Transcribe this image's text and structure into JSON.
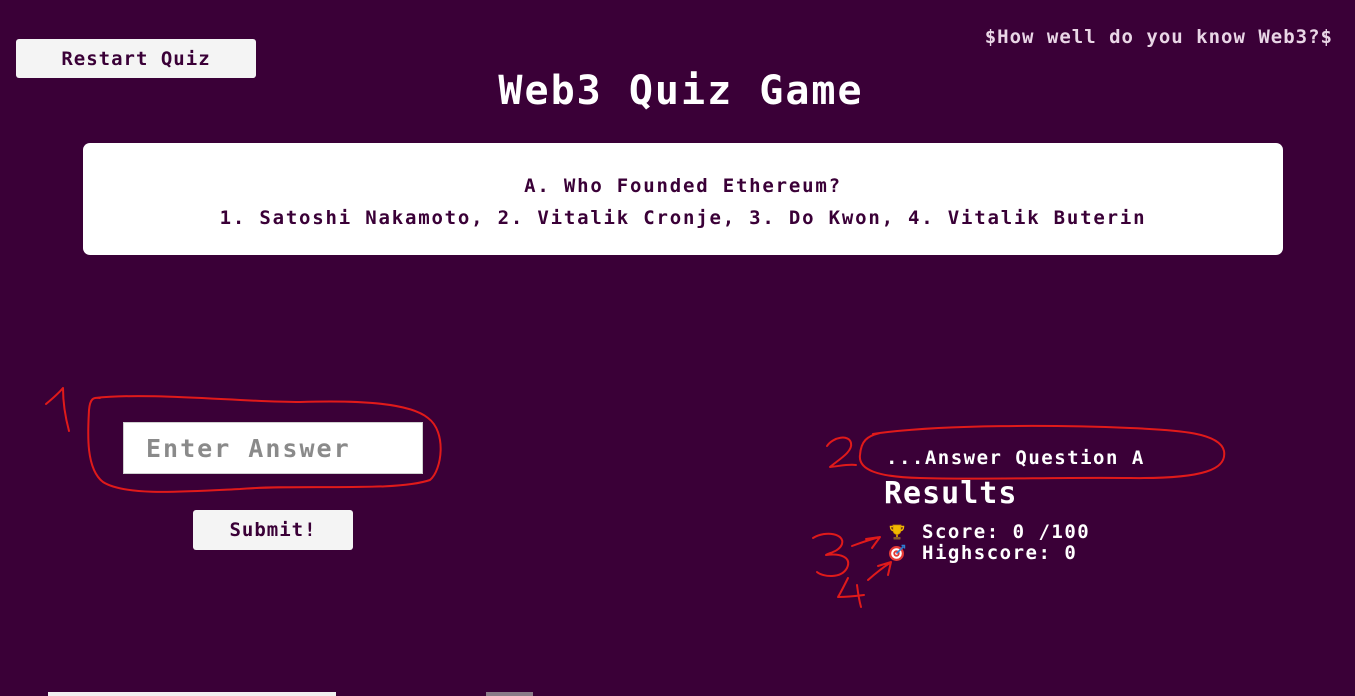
{
  "header": {
    "restart_label": "Restart Quiz",
    "tagline": "$How well do you know Web3?$",
    "title": "Web3 Quiz Game"
  },
  "question": {
    "prompt": "A. Who Founded Ethereum?",
    "options": "1. Satoshi Nakamoto, 2. Vitalik Cronje, 3. Do Kwon, 4. Vitalik Buterin"
  },
  "answer_form": {
    "placeholder": "Enter Answer",
    "value": "",
    "submit_label": "Submit!"
  },
  "results": {
    "status": "...Answer Question A",
    "heading": "Results",
    "score_label": "Score: 0 /100",
    "highscore_label": "Highscore: 0",
    "score_icon": "trophy-icon",
    "highscore_icon": "target-icon"
  },
  "annotations": {
    "color": "#e01a1a",
    "labels": [
      "1",
      "2",
      "3",
      "4"
    ]
  },
  "colors": {
    "background": "#3a0037",
    "card": "#ffffff",
    "button": "#f4f4f4"
  }
}
